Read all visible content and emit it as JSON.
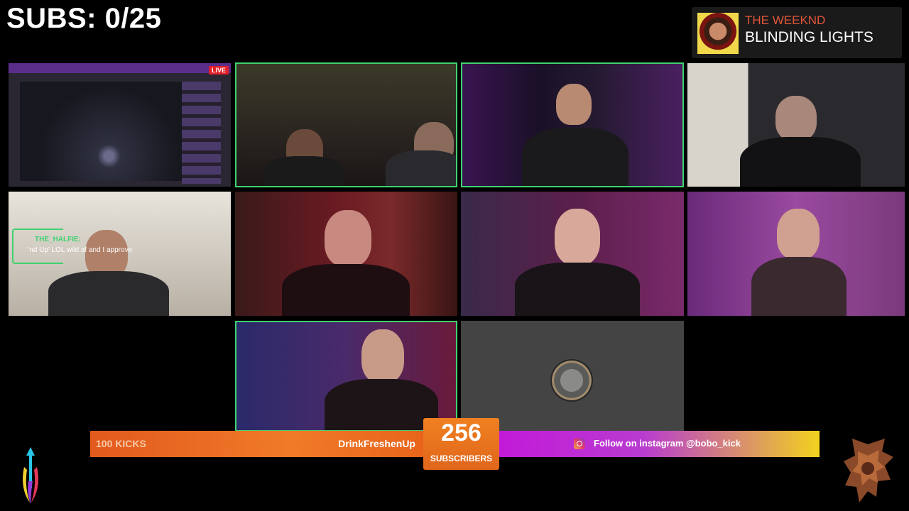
{
  "overlay": {
    "subs_goal": "SUBS: 0/25"
  },
  "now_playing": {
    "artist": "THE WEEKND",
    "song": "BLINDING LIGHTS"
  },
  "screen_share": {
    "live_badge": "LIVE"
  },
  "chat_popup": {
    "username": "THE_HALFIE:",
    "message": "’nd Up’ LOL wild af and I approve"
  },
  "ticker": {
    "left_label": "100 KICKS",
    "left_sponsor": "DrinkFreshenUp",
    "subscriber_count": "256",
    "subscriber_label": "SUBSCRIBERS",
    "right_text": "Follow on instagram @bobo_kick",
    "left_color": "#e8641c",
    "right_color_start": "#c21ad8",
    "right_color_end": "#f2d21e"
  },
  "icons": {
    "instagram": "instagram-icon",
    "left_logo": "kick-arrows-logo",
    "right_logo": "bronze-crest-logo"
  }
}
